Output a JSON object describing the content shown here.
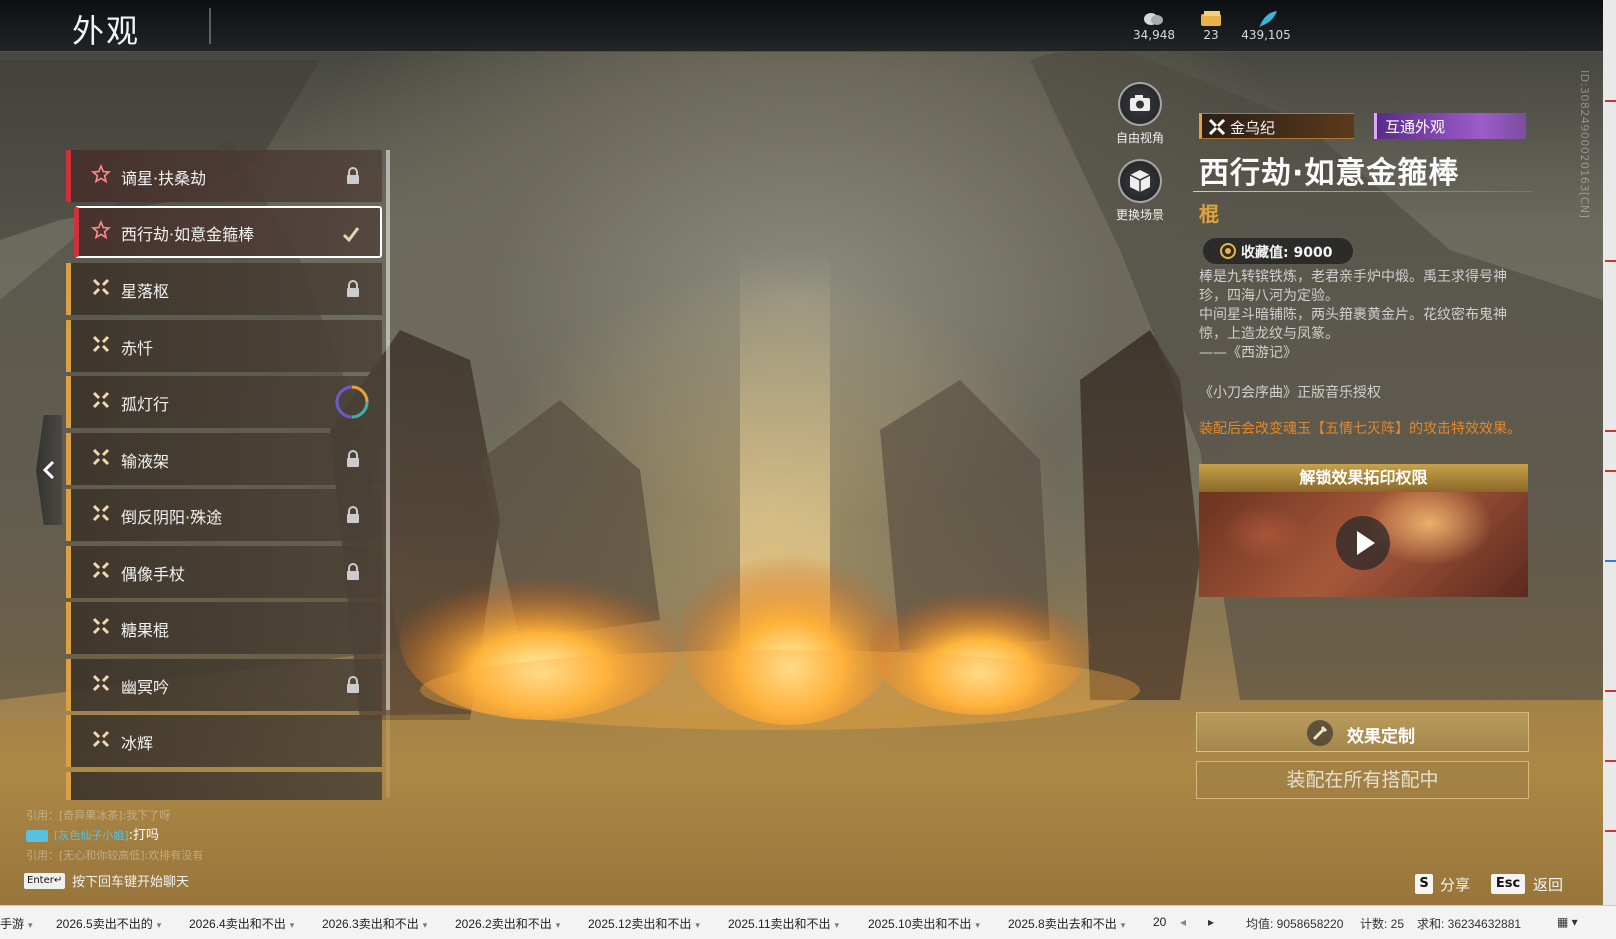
{
  "header": {
    "title": "外观",
    "currencies": [
      {
        "icon": "coin-stack-icon",
        "value": "34,948"
      },
      {
        "icon": "ticket-icon",
        "value": "23"
      },
      {
        "icon": "feather-icon",
        "value": "439,105"
      }
    ]
  },
  "skin_list": {
    "items": [
      {
        "label": "谪星·扶桑劫",
        "rarity": "red",
        "status": "locked"
      },
      {
        "label": "西行劫·如意金箍棒",
        "rarity": "red",
        "status": "equipped-selected"
      },
      {
        "label": "星落枢",
        "rarity": "gold",
        "status": "locked"
      },
      {
        "label": "赤忏",
        "rarity": "gold",
        "status": "none"
      },
      {
        "label": "孤灯行",
        "rarity": "gold",
        "status": "dyeable"
      },
      {
        "label": "输液架",
        "rarity": "gold",
        "status": "locked"
      },
      {
        "label": "倒反阴阳·殊途",
        "rarity": "gold",
        "status": "locked"
      },
      {
        "label": "偶像手杖",
        "rarity": "gold",
        "status": "locked"
      },
      {
        "label": "糖果棍",
        "rarity": "gold",
        "status": "none"
      },
      {
        "label": "幽冥吟",
        "rarity": "gold",
        "status": "locked"
      },
      {
        "label": "冰辉",
        "rarity": "gold",
        "status": "none"
      }
    ]
  },
  "view_controls": {
    "free_view": "自由视角",
    "change_scene": "更换场景"
  },
  "detail": {
    "set_tag": "金乌纪",
    "share_tag": "互通外观",
    "title": "西行劫·如意金箍棒",
    "weapon_type": "棍",
    "collect_label": "收藏值: 9000",
    "description": [
      "棒是九转镔铁炼，老君亲手炉中煅。禹王求得号神珍，四海八河为定验。",
      "中间星斗暗铺陈，两头箝裹黄金片。花纹密布鬼神惊，上造龙纹与凤篆。",
      "——《西游记》"
    ],
    "license": "《小刀会序曲》正版音乐授权",
    "effect_note": "装配后会改变魂玉【五情七灭阵】的攻击特效效果。",
    "unlock_title": "解锁效果拓印权限",
    "custom_button": "效果定制",
    "equip_button": "装配在所有搭配中"
  },
  "chat": {
    "quote1": "引用：[奇异果冰茶]:我下了呀",
    "sender": "[灰色仙子小姐]",
    "message": ":打吗",
    "quote2": "引用：[无心和你较高低]:欢排有没有",
    "enter_key": "Enter↵",
    "hint": "按下回车键开始聊天"
  },
  "hotkeys": {
    "share_key": "S",
    "share_label": "分享",
    "back_key": "Esc",
    "back_label": "返回"
  },
  "id_text": "ID:3082490002016​3[CN]",
  "sheet_bar": {
    "tabs": [
      "手游",
      "2026.5卖出不出的",
      "2026.4卖出和不出",
      "2026.3卖出和不出",
      "2026.2卖出和不出",
      "2025.12卖出和不出",
      "2025.11卖出和不出",
      "2025.10卖出和不出",
      "2025.8卖出去和不出",
      "20"
    ],
    "avg": "均值: 9058658220",
    "count": "计数: 25",
    "sum": "求和: 36234632881"
  },
  "colors": {
    "accent_gold": "#d9a047",
    "accent_red": "#d0303a",
    "effect_orange": "#e3882a",
    "share_purple": "#9d5cc9"
  }
}
